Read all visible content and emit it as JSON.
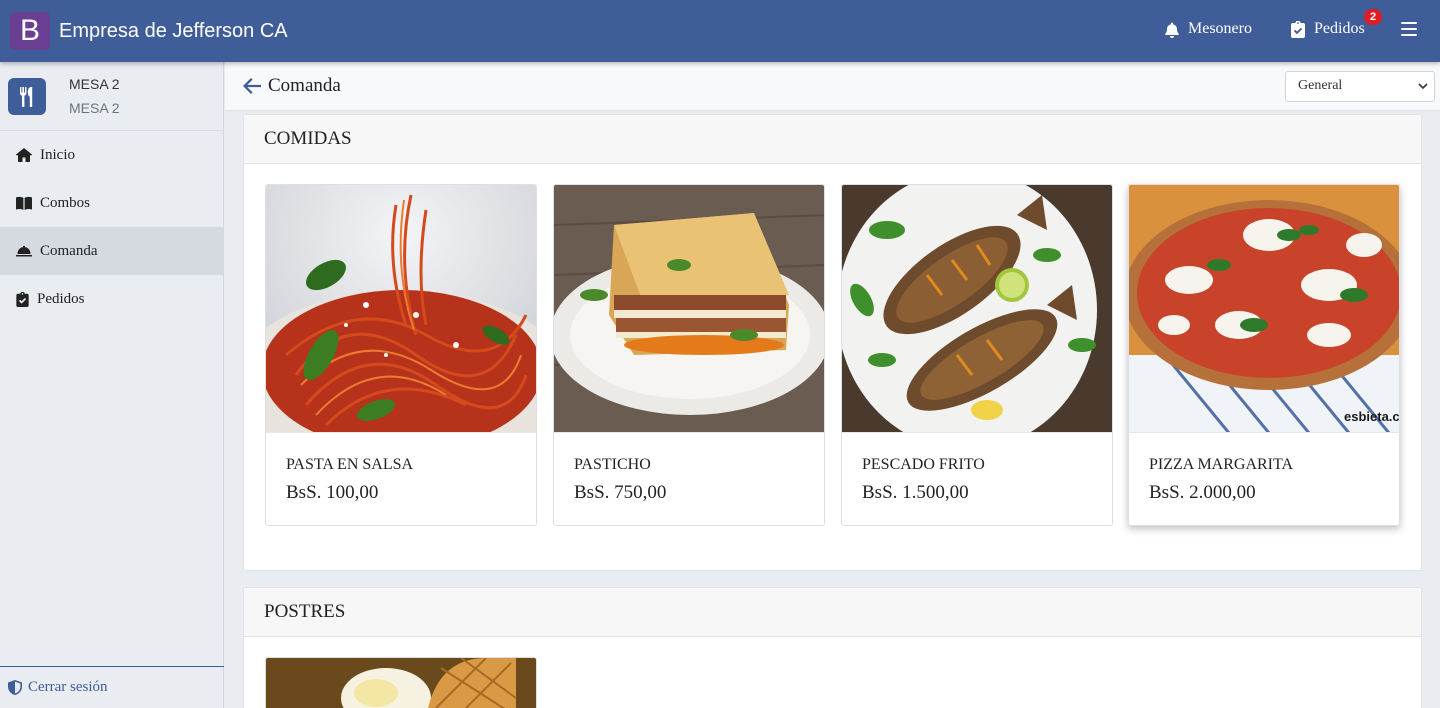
{
  "header": {
    "logo_letter": "B",
    "company_name": "Empresa de Jefferson CA",
    "mesonero_label": "Mesonero",
    "pedidos_label": "Pedidos",
    "pedidos_badge": "2",
    "colors": {
      "primary": "#3f5d98",
      "logo": "#6a3f93",
      "badge": "#e01c24"
    }
  },
  "sidebar": {
    "mesa_title": "MESA 2",
    "mesa_subtitle": "MESA 2",
    "items": [
      {
        "label": "Inicio",
        "icon": "home-icon",
        "active": false
      },
      {
        "label": "Combos",
        "icon": "book-icon",
        "active": false
      },
      {
        "label": "Comanda",
        "icon": "bell-service-icon",
        "active": true
      },
      {
        "label": "Pedidos",
        "icon": "clipboard-check-icon",
        "active": false
      }
    ],
    "logout_label": "Cerrar sesión"
  },
  "subheader": {
    "title": "Comanda",
    "select_value": "General"
  },
  "sections": [
    {
      "title": "COMIDAS",
      "items": [
        {
          "name": "PASTA EN SALSA",
          "price": "BsS. 100,00",
          "image": "pasta-image"
        },
        {
          "name": "PASTICHO",
          "price": "BsS. 750,00",
          "image": "lasagna-image"
        },
        {
          "name": "PESCADO FRITO",
          "price": "BsS. 1.500,00",
          "image": "fried-fish-image"
        },
        {
          "name": "PIZZA MARGARITA",
          "price": "BsS. 2.000,00",
          "image": "pizza-image",
          "watermark": "esbieta.c"
        }
      ]
    },
    {
      "title": "POSTRES",
      "items": [
        {
          "image": "waffle-dessert-image"
        }
      ]
    }
  ]
}
